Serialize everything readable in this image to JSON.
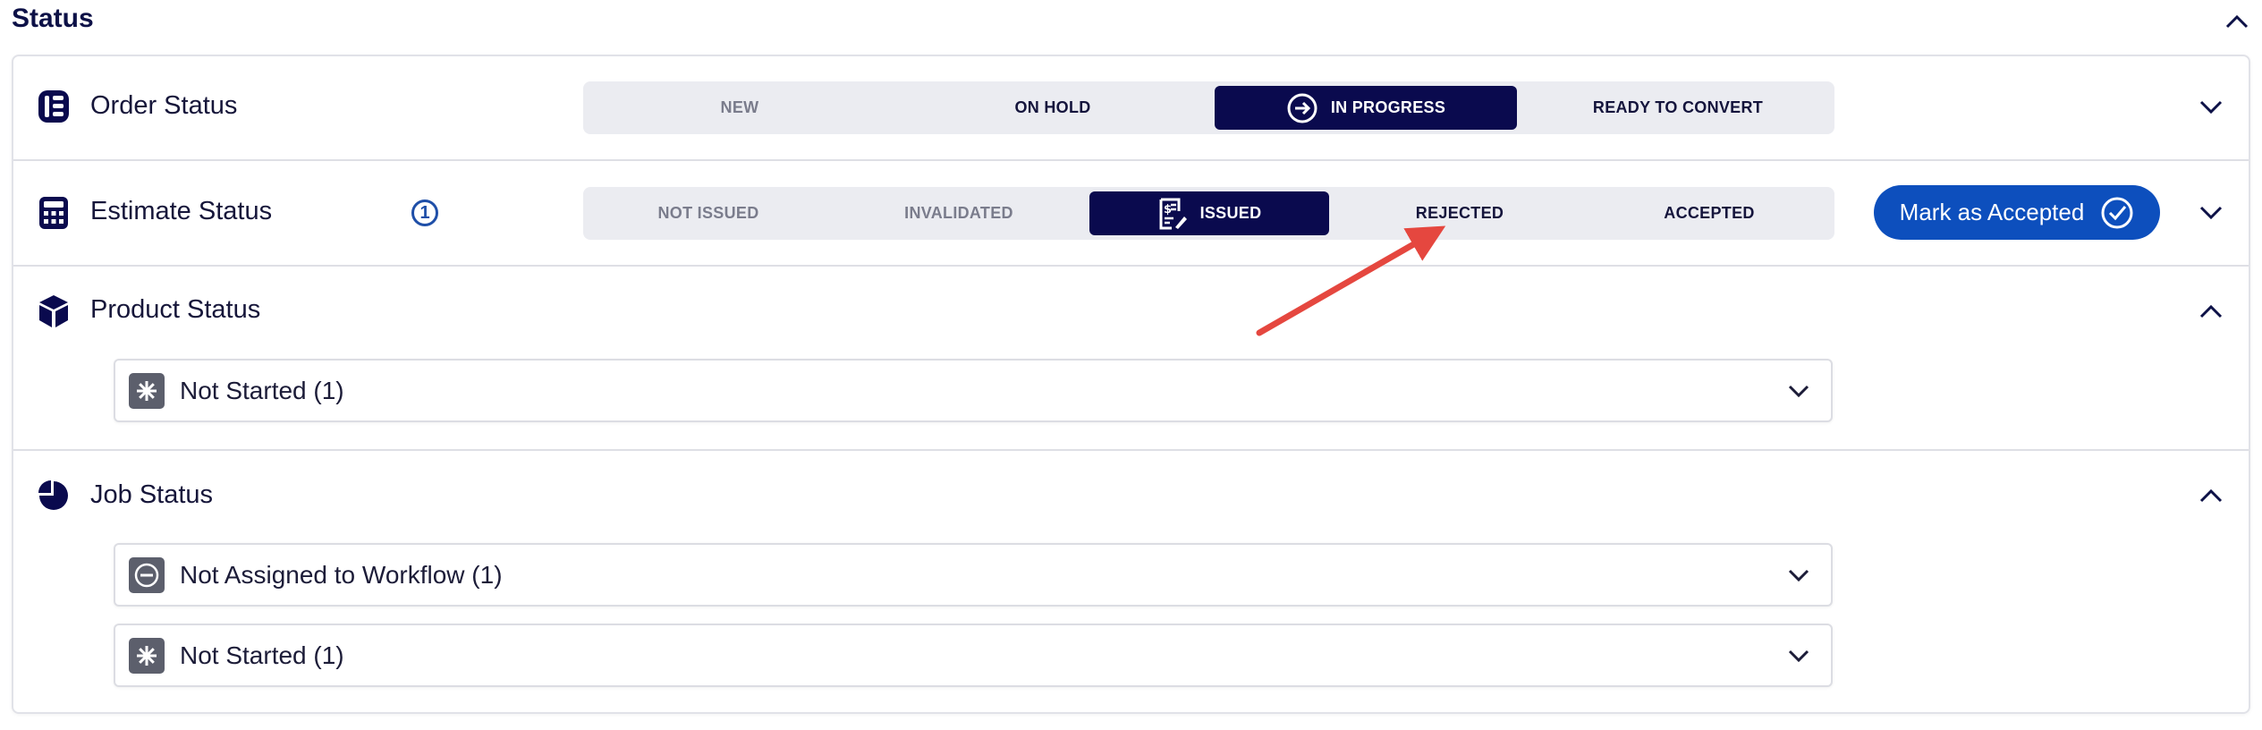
{
  "header": {
    "title": "Status"
  },
  "order_status": {
    "title": "Order Status",
    "steps": [
      {
        "label": "NEW",
        "state": "muted"
      },
      {
        "label": "ON HOLD",
        "state": "normal"
      },
      {
        "label": "IN PROGRESS",
        "state": "active"
      },
      {
        "label": "READY TO CONVERT",
        "state": "normal"
      }
    ]
  },
  "estimate_status": {
    "title": "Estimate Status",
    "badge": "1",
    "steps": [
      {
        "label": "NOT ISSUED",
        "state": "muted"
      },
      {
        "label": "INVALIDATED",
        "state": "muted"
      },
      {
        "label": "ISSUED",
        "state": "active"
      },
      {
        "label": "REJECTED",
        "state": "normal"
      },
      {
        "label": "ACCEPTED",
        "state": "normal"
      }
    ],
    "action_label": "Mark as Accepted"
  },
  "product_status": {
    "title": "Product Status",
    "items": [
      {
        "label": "Not Started (1)",
        "icon": "asterisk-icon"
      }
    ]
  },
  "job_status": {
    "title": "Job Status",
    "items": [
      {
        "label": "Not Assigned to Workflow (1)",
        "icon": "minus-circle-icon"
      },
      {
        "label": "Not Started (1)",
        "icon": "asterisk-icon"
      }
    ]
  },
  "colors": {
    "navy": "#0a0a4e",
    "primary_blue": "#0d4fbd",
    "annotation_arrow": "#e5473f",
    "track_bg": "#ebecf1"
  }
}
